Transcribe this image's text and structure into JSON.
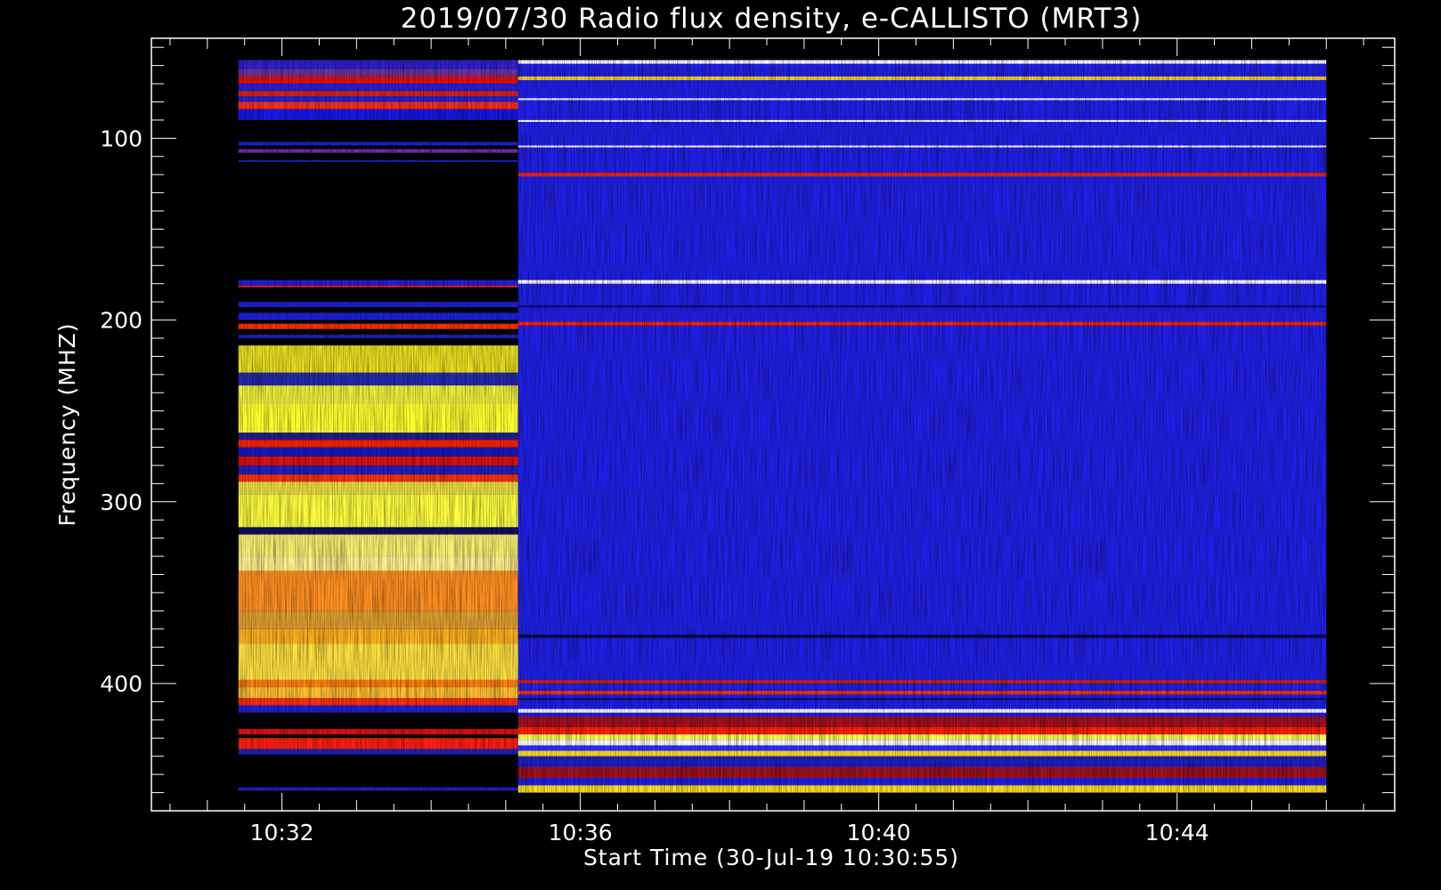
{
  "chart_data": {
    "type": "heatmap",
    "title": "2019/07/30  Radio flux density, e-CALLISTO (MRT3)",
    "xlabel": "Start Time (30-Jul-19 10:30:55)",
    "ylabel": "Frequency (MHZ)",
    "x_range_minutes": [
      "10:30:15",
      "10:46:55"
    ],
    "data_x_range": [
      "10:31:25",
      "10:46:00"
    ],
    "instrument_change_time": "10:35:10",
    "ylim": [
      45,
      470
    ],
    "y_axis_inverted": true,
    "data_y_range": [
      57,
      460
    ],
    "x_ticks": [
      "10:32",
      "10:36",
      "10:40",
      "10:44"
    ],
    "y_ticks": [
      100,
      200,
      300,
      400
    ],
    "colors": {
      "background": "#000000",
      "low": "#1010e0",
      "mid": "#ff2000",
      "high": "#ffff40",
      "peak": "#ffffff"
    },
    "segments": [
      {
        "name": "early",
        "bands": [
          {
            "f1": 57,
            "f2": 62,
            "color": "#3020d0"
          },
          {
            "f1": 62,
            "f2": 66,
            "color": "#7030a0"
          },
          {
            "f1": 66,
            "f2": 70,
            "color": "#e01010"
          },
          {
            "f1": 70,
            "f2": 74,
            "color": "#2020e0"
          },
          {
            "f1": 74,
            "f2": 77,
            "color": "#e02010"
          },
          {
            "f1": 77,
            "f2": 80,
            "color": "#2020e0"
          },
          {
            "f1": 80,
            "f2": 84,
            "color": "#ff3010"
          },
          {
            "f1": 84,
            "f2": 90,
            "color": "#1818e8"
          },
          {
            "f1": 102,
            "f2": 104,
            "color": "#2020d0"
          },
          {
            "f1": 106,
            "f2": 108,
            "color": "#7030b0"
          },
          {
            "f1": 112,
            "f2": 113,
            "color": "#2020d0"
          },
          {
            "f1": 178,
            "f2": 181,
            "color": "#2020e0"
          },
          {
            "f1": 181,
            "f2": 182,
            "color": "#ff2000"
          },
          {
            "f1": 190,
            "f2": 193,
            "color": "#2020d0"
          },
          {
            "f1": 196,
            "f2": 200,
            "color": "#2020e0"
          },
          {
            "f1": 202,
            "f2": 205,
            "color": "#ff3000"
          },
          {
            "f1": 208,
            "f2": 210,
            "color": "#2020c0"
          },
          {
            "f1": 214,
            "f2": 229,
            "color": "#e8e020"
          },
          {
            "f1": 229,
            "f2": 236,
            "color": "#2828b0"
          },
          {
            "f1": 236,
            "f2": 246,
            "color": "#f0f040"
          },
          {
            "f1": 246,
            "f2": 262,
            "color": "#ffff30"
          },
          {
            "f1": 262,
            "f2": 266,
            "color": "#202090"
          },
          {
            "f1": 266,
            "f2": 270,
            "color": "#ff2000"
          },
          {
            "f1": 270,
            "f2": 275,
            "color": "#1818c0"
          },
          {
            "f1": 275,
            "f2": 280,
            "color": "#e01010"
          },
          {
            "f1": 280,
            "f2": 285,
            "color": "#2020c0"
          },
          {
            "f1": 285,
            "f2": 289,
            "color": "#ff3010"
          },
          {
            "f1": 289,
            "f2": 296,
            "color": "#f0e040"
          },
          {
            "f1": 296,
            "f2": 314,
            "color": "#ffff40"
          },
          {
            "f1": 314,
            "f2": 318,
            "color": "#101060"
          },
          {
            "f1": 318,
            "f2": 330,
            "color": "#f8f070"
          },
          {
            "f1": 330,
            "f2": 338,
            "color": "#fff090"
          },
          {
            "f1": 338,
            "f2": 360,
            "color": "#ff9020"
          },
          {
            "f1": 360,
            "f2": 370,
            "color": "#e0a030"
          },
          {
            "f1": 370,
            "f2": 378,
            "color": "#ffb020"
          },
          {
            "f1": 378,
            "f2": 398,
            "color": "#ffe040"
          },
          {
            "f1": 398,
            "f2": 402,
            "color": "#ff8010"
          },
          {
            "f1": 402,
            "f2": 408,
            "color": "#ffc030"
          },
          {
            "f1": 408,
            "f2": 412,
            "color": "#ff3010"
          },
          {
            "f1": 412,
            "f2": 416,
            "color": "#2020d0"
          },
          {
            "f1": 425,
            "f2": 428,
            "color": "#e01010"
          },
          {
            "f1": 430,
            "f2": 436,
            "color": "#ff2010"
          },
          {
            "f1": 436,
            "f2": 439,
            "color": "#2020c0"
          },
          {
            "f1": 457,
            "f2": 459,
            "color": "#2020c0"
          }
        ]
      },
      {
        "name": "late",
        "base_color": "#2020e8",
        "bands": [
          {
            "f1": 57,
            "f2": 59,
            "color": "#ffffff"
          },
          {
            "f1": 66,
            "f2": 68,
            "color": "#ffd020"
          },
          {
            "f1": 78,
            "f2": 79,
            "color": "#ffffff"
          },
          {
            "f1": 90,
            "f2": 91,
            "color": "#ffffff"
          },
          {
            "f1": 104,
            "f2": 105,
            "color": "#ffffff"
          },
          {
            "f1": 119,
            "f2": 121,
            "color": "#ff2000"
          },
          {
            "f1": 178,
            "f2": 180,
            "color": "#ffffff"
          },
          {
            "f1": 192,
            "f2": 193,
            "color": "#0a0a70"
          },
          {
            "f1": 201,
            "f2": 203,
            "color": "#ff2000"
          },
          {
            "f1": 373,
            "f2": 375,
            "color": "#0a0a60"
          },
          {
            "f1": 398,
            "f2": 400,
            "color": "#c02020"
          },
          {
            "f1": 404,
            "f2": 406,
            "color": "#ff3000"
          },
          {
            "f1": 408,
            "f2": 409,
            "color": "#0a0a60"
          },
          {
            "f1": 414,
            "f2": 416,
            "color": "#ffffff"
          },
          {
            "f1": 418,
            "f2": 424,
            "color": "#a01020"
          },
          {
            "f1": 424,
            "f2": 428,
            "color": "#ff2000"
          },
          {
            "f1": 428,
            "f2": 431,
            "color": "#ffff50"
          },
          {
            "f1": 431,
            "f2": 434,
            "color": "#ffffff"
          },
          {
            "f1": 434,
            "f2": 437,
            "color": "#3030ff"
          },
          {
            "f1": 437,
            "f2": 440,
            "color": "#ffe030"
          },
          {
            "f1": 440,
            "f2": 446,
            "color": "#2020c0"
          },
          {
            "f1": 446,
            "f2": 452,
            "color": "#a01020"
          },
          {
            "f1": 456,
            "f2": 460,
            "color": "#ffe020"
          }
        ]
      }
    ]
  }
}
